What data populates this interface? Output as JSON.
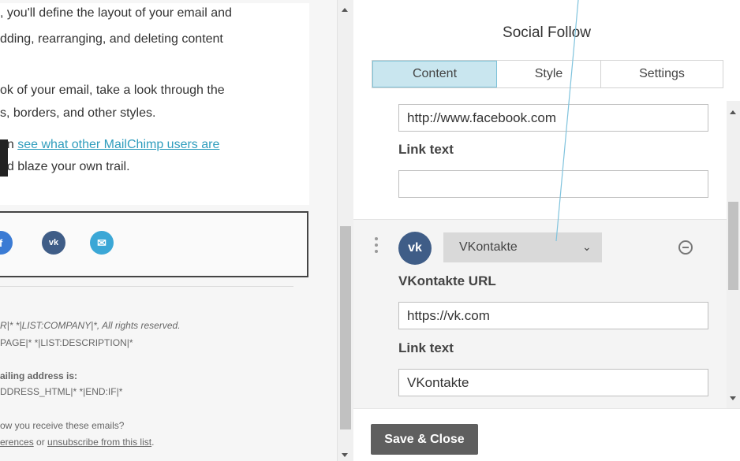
{
  "preview": {
    "lines": [
      ", you'll define the layout of your email and",
      "dding, rearranging, and deleting content",
      "ok of your email, take a look through the",
      "s, borders, and other styles.",
      "an ",
      "see what other MailChimp users are",
      "nd blaze your own trail."
    ],
    "social_icons": [
      "facebook-icon",
      "vk-icon",
      "email-icon"
    ],
    "social_glyphs": [
      "f",
      "vk",
      "✉"
    ],
    "footer": {
      "line1": "R|* *|LIST:COMPANY|*, All rights reserved.",
      "line2": "PAGE|* *|LIST:DESCRIPTION|*",
      "line3": "ailing address is:",
      "line4": "DDRESS_HTML|* *|END:IF|*",
      "line5": "ow you receive these emails?",
      "line6_a": "erences",
      "line6_b": " or ",
      "line6_c": "unsubscribe from this list",
      "line6_d": "."
    }
  },
  "editor": {
    "title": "Social Follow",
    "tabs": [
      "Content",
      "Style",
      "Settings"
    ],
    "active_tab": "Content",
    "item1": {
      "url_value": "http://www.facebook.com",
      "link_text_label": "Link text",
      "link_text_value": ""
    },
    "item2": {
      "badge": "vk",
      "service": "VKontakte",
      "chevron": "⌄",
      "url_label": "VKontakte URL",
      "url_value": "https://vk.com",
      "link_text_label": "Link text",
      "link_text_value": "VKontakte"
    },
    "save_label": "Save & Close"
  },
  "colors": {
    "tab_active_bg": "#c9e6ef",
    "vk_blue": "#3f5d87",
    "save_bg": "#5f5f5f",
    "link": "#2f9dbd"
  }
}
